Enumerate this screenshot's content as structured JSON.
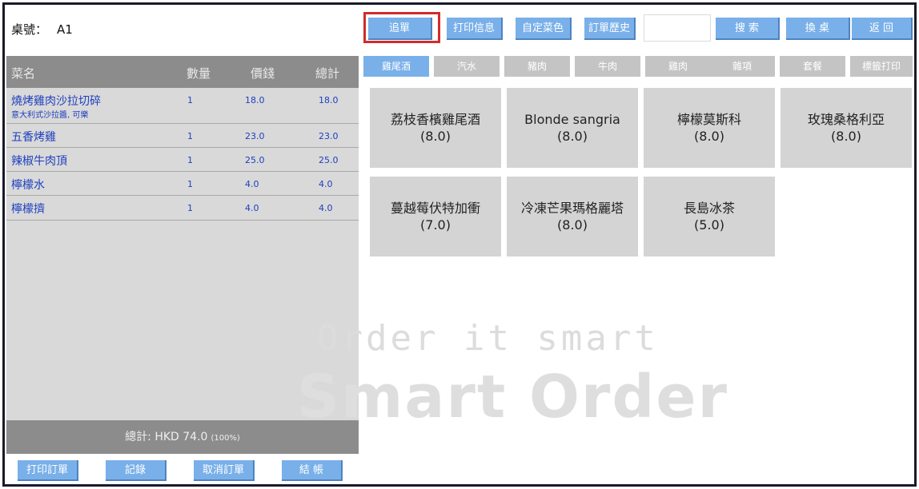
{
  "header": {
    "table_label": "桌號：",
    "table_value": "A1"
  },
  "order": {
    "columns": [
      "菜名",
      "數量",
      "價錢",
      "總計"
    ],
    "rows": [
      {
        "name": "燒烤雞肉沙拉切碎",
        "note": "意大利式沙拉醬, 可樂",
        "qty": "1",
        "price": "18.0",
        "total": "18.0"
      },
      {
        "name": "五香烤雞",
        "note": "",
        "qty": "1",
        "price": "23.0",
        "total": "23.0"
      },
      {
        "name": "辣椒牛肉頂",
        "note": "",
        "qty": "1",
        "price": "25.0",
        "total": "25.0"
      },
      {
        "name": "檸檬水",
        "note": "",
        "qty": "1",
        "price": "4.0",
        "total": "4.0"
      },
      {
        "name": "檸檬擠",
        "note": "",
        "qty": "1",
        "price": "4.0",
        "total": "4.0"
      }
    ],
    "summary_label": "總計: HKD 74.0",
    "summary_pct": "(100%)"
  },
  "bottom_buttons": [
    "打印訂單",
    "記錄",
    "取消訂單",
    "結 帳"
  ],
  "toolbar": {
    "buttons": [
      "追單",
      "打印信息",
      "自定菜色",
      "訂單歷史"
    ],
    "search_value": "",
    "search_label": "搜 索",
    "change_table_label": "換 桌",
    "back_label": "返 回"
  },
  "categories": [
    "雞尾酒",
    "汽水",
    "豬肉",
    "牛肉",
    "雞肉",
    "雜項",
    "套餐",
    "標籤打印"
  ],
  "menu_items": [
    {
      "name": "荔枝香檳雞尾酒",
      "price": "(8.0)"
    },
    {
      "name": "Blonde sangria",
      "price": "(8.0)"
    },
    {
      "name": "檸檬莫斯科",
      "price": "(8.0)"
    },
    {
      "name": "玫瑰桑格利亞",
      "price": "(8.0)"
    },
    {
      "name": "蔓越莓伏特加衝",
      "price": "(7.0)"
    },
    {
      "name": "冷凍芒果瑪格麗塔",
      "price": "(8.0)"
    },
    {
      "name": "長島冰茶",
      "price": "(5.0)"
    }
  ],
  "watermark": {
    "line1": "Order it smart",
    "line2": "Smart Order"
  },
  "colors": {
    "button_blue": "#79b0e9",
    "header_gray": "#8c8c8c",
    "order_text": "#1e3fbf",
    "highlight_red": "#d32b2b"
  }
}
